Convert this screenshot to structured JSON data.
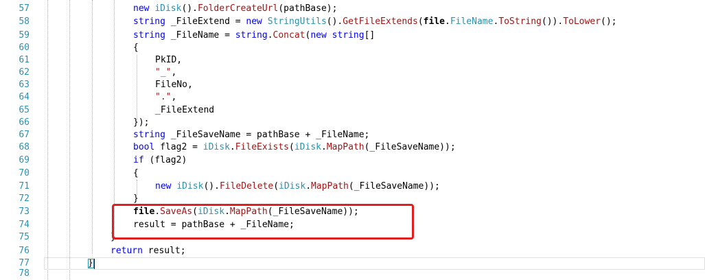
{
  "editor": {
    "lines": [
      {
        "num": "57",
        "tokens": [
          [
            "kw",
            "new "
          ],
          [
            "ty",
            "iDisk"
          ],
          [
            "id",
            "()."
          ],
          [
            "fn",
            "FolderCreateUrl"
          ],
          [
            "id",
            "(pathBase);"
          ]
        ]
      },
      {
        "num": "58",
        "tokens": [
          [
            "kw",
            "string "
          ],
          [
            "id",
            "_FileExtend = "
          ],
          [
            "kw",
            "new "
          ],
          [
            "ty",
            "StringUtils"
          ],
          [
            "id",
            "()."
          ],
          [
            "fn",
            "GetFileExtends"
          ],
          [
            "id",
            "("
          ],
          [
            "bold",
            "file"
          ],
          [
            "id",
            "."
          ],
          [
            "ty",
            "FileName"
          ],
          [
            "id",
            "."
          ],
          [
            "fn",
            "ToString"
          ],
          [
            "id",
            "())."
          ],
          [
            "fn",
            "ToLower"
          ],
          [
            "id",
            "();"
          ]
        ]
      },
      {
        "num": "59",
        "tokens": [
          [
            "kw",
            "string "
          ],
          [
            "id",
            "_FileName = "
          ],
          [
            "kw",
            "string"
          ],
          [
            "id",
            "."
          ],
          [
            "fn",
            "Concat"
          ],
          [
            "id",
            "("
          ],
          [
            "kw",
            "new string"
          ],
          [
            "id",
            "[]"
          ]
        ]
      },
      {
        "num": "60",
        "tokens": [
          [
            "id",
            "{"
          ]
        ]
      },
      {
        "num": "61",
        "tokens": [
          [
            "id",
            "PkID,"
          ]
        ]
      },
      {
        "num": "62",
        "tokens": [
          [
            "str",
            "\"_\""
          ],
          [
            "id",
            ","
          ]
        ]
      },
      {
        "num": "63",
        "tokens": [
          [
            "id",
            "FileNo,"
          ]
        ]
      },
      {
        "num": "64",
        "tokens": [
          [
            "str",
            "\".\""
          ],
          [
            "id",
            ","
          ]
        ]
      },
      {
        "num": "65",
        "tokens": [
          [
            "id",
            "_FileExtend"
          ]
        ]
      },
      {
        "num": "66",
        "tokens": [
          [
            "id",
            "});"
          ]
        ]
      },
      {
        "num": "67",
        "tokens": [
          [
            "kw",
            "string "
          ],
          [
            "id",
            "_FileSaveName = pathBase + _FileName;"
          ]
        ]
      },
      {
        "num": "68",
        "tokens": [
          [
            "kw",
            "bool "
          ],
          [
            "id",
            "flag2 = "
          ],
          [
            "ty",
            "iDisk"
          ],
          [
            "id",
            "."
          ],
          [
            "fn",
            "FileExists"
          ],
          [
            "id",
            "("
          ],
          [
            "ty",
            "iDisk"
          ],
          [
            "id",
            "."
          ],
          [
            "fn",
            "MapPath"
          ],
          [
            "id",
            "(_FileSaveName));"
          ]
        ]
      },
      {
        "num": "69",
        "tokens": [
          [
            "kw",
            "if "
          ],
          [
            "id",
            "(flag2)"
          ]
        ]
      },
      {
        "num": "70",
        "tokens": [
          [
            "id",
            "{"
          ]
        ]
      },
      {
        "num": "71",
        "tokens": [
          [
            "kw",
            "new "
          ],
          [
            "ty",
            "iDisk"
          ],
          [
            "id",
            "()."
          ],
          [
            "fn",
            "FileDelete"
          ],
          [
            "id",
            "("
          ],
          [
            "ty",
            "iDisk"
          ],
          [
            "id",
            "."
          ],
          [
            "fn",
            "MapPath"
          ],
          [
            "id",
            "(_FileSaveName));"
          ]
        ]
      },
      {
        "num": "72",
        "tokens": [
          [
            "id",
            "}"
          ]
        ]
      },
      {
        "num": "73",
        "tokens": [
          [
            "bold",
            "file"
          ],
          [
            "id",
            "."
          ],
          [
            "fn",
            "SaveAs"
          ],
          [
            "id",
            "("
          ],
          [
            "ty",
            "iDisk"
          ],
          [
            "id",
            "."
          ],
          [
            "fn",
            "MapPath"
          ],
          [
            "id",
            "(_FileSaveName));"
          ]
        ]
      },
      {
        "num": "74",
        "tokens": [
          [
            "id",
            "result = pathBase + _FileName;"
          ]
        ]
      },
      {
        "num": "75",
        "tokens": [
          [
            "id",
            "}"
          ]
        ]
      },
      {
        "num": "76",
        "tokens": [
          [
            "kw",
            "return "
          ],
          [
            "id",
            "result;"
          ]
        ]
      },
      {
        "num": "77",
        "tokens": [
          [
            "id",
            "}"
          ]
        ]
      },
      {
        "num": "78",
        "tokens": []
      }
    ]
  },
  "colors": {
    "line_number": "#2b91af",
    "keyword": "#0000ff",
    "type": "#2b91af",
    "method": "#a31515",
    "highlight_box": "#e02020"
  }
}
